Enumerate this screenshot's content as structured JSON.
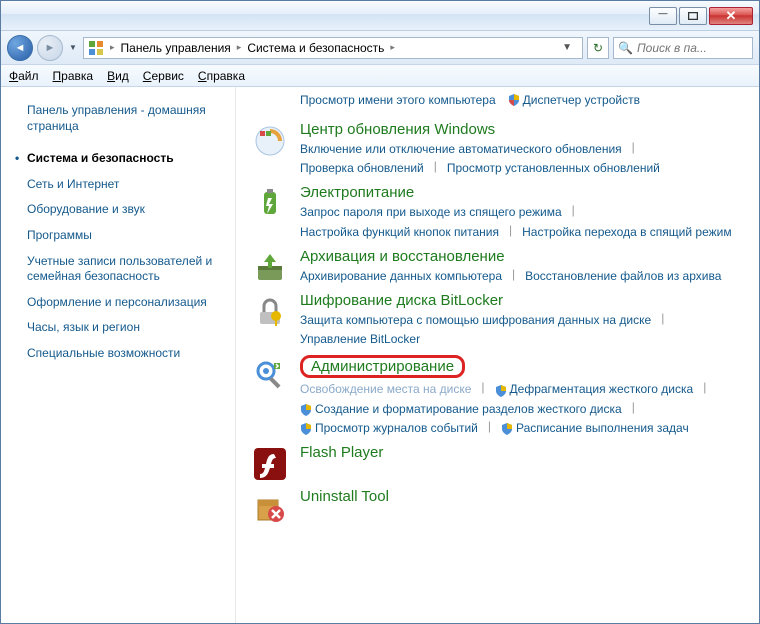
{
  "breadcrumb": {
    "root": "Панель управления",
    "section": "Система и безопасность"
  },
  "search": {
    "placeholder": "Поиск в па..."
  },
  "menu": {
    "file": "Файл",
    "edit": "Правка",
    "view": "Вид",
    "tools": "Сервис",
    "help": "Справка"
  },
  "sidebar": {
    "home": "Панель управления - домашняя страница",
    "items": [
      "Система и безопасность",
      "Сеть и Интернет",
      "Оборудование и звук",
      "Программы",
      "Учетные записи пользователей и семейная безопасность",
      "Оформление и персонализация",
      "Часы, язык и регион",
      "Специальные возможности"
    ]
  },
  "toplinks": {
    "a": "Просмотр имени этого компьютера",
    "b": "Диспетчер устройств"
  },
  "cats": [
    {
      "title": "Центр обновления Windows",
      "links": [
        "Включение или отключение автоматического обновления",
        "Проверка обновлений",
        "Просмотр установленных обновлений"
      ],
      "shielded": []
    },
    {
      "title": "Электропитание",
      "links": [
        "Запрос пароля при выходе из спящего режима",
        "Настройка функций кнопок питания",
        "Настройка перехода в спящий режим"
      ],
      "shielded": []
    },
    {
      "title": "Архивация и восстановление",
      "links": [
        "Архивирование данных компьютера",
        "Восстановление файлов из архива"
      ],
      "shielded": []
    },
    {
      "title": "Шифрование диска BitLocker",
      "links": [
        "Защита компьютера с помощью шифрования данных на диске",
        "Управление BitLocker"
      ],
      "shielded": []
    },
    {
      "title": "Администрирование",
      "links": [
        "Освобождение места на диске",
        "Дефрагментация жесткого диска",
        "Создание и форматирование разделов жесткого диска",
        "Просмотр журналов событий",
        "Расписание выполнения задач"
      ],
      "shielded": [
        1,
        2,
        3,
        4
      ]
    },
    {
      "title": "Flash Player",
      "links": [],
      "shielded": []
    },
    {
      "title": "Uninstall Tool",
      "links": [],
      "shielded": []
    }
  ]
}
